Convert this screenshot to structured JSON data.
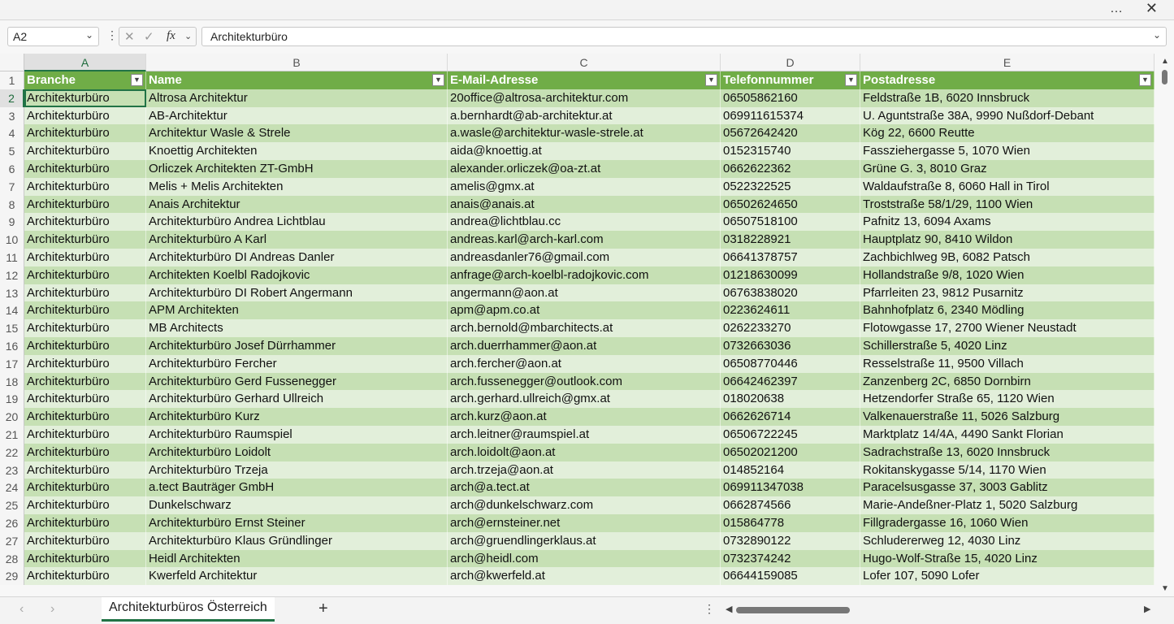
{
  "window": {
    "more_icon": "…",
    "close_icon": "✕"
  },
  "formula_bar": {
    "name_box": "A2",
    "formula": "Architekturbüro",
    "fx": "fx"
  },
  "columns": [
    "A",
    "B",
    "C",
    "D",
    "E"
  ],
  "headers": [
    "Branche",
    "Name",
    "E-Mail-Adresse",
    "Telefonnummer",
    "Postadresse"
  ],
  "rows": [
    [
      "2",
      "Architekturbüro",
      "Altrosa Architektur",
      "20office@altrosa-architektur.com",
      "06505862160",
      "Feldstraße 1B, 6020 Innsbruck"
    ],
    [
      "3",
      "Architekturbüro",
      "AB-Architektur",
      "a.bernhardt@ab-architektur.at",
      "069911615374",
      "U. Aguntstraße 38A, 9990 Nußdorf-Debant"
    ],
    [
      "4",
      "Architekturbüro",
      "Architektur Wasle & Strele",
      "a.wasle@architektur-wasle-strele.at",
      "05672642420",
      "Kög 22, 6600 Reutte"
    ],
    [
      "5",
      "Architekturbüro",
      "Knoettig Architekten",
      "aida@knoettig.at",
      "0152315740",
      "Fassziehergasse 5, 1070 Wien"
    ],
    [
      "6",
      "Architekturbüro",
      "Orliczek Architekten ZT-GmbH",
      "alexander.orliczek@oa-zt.at",
      "0662622362",
      "Grüne G. 3, 8010 Graz"
    ],
    [
      "7",
      "Architekturbüro",
      "Melis + Melis Architekten",
      "amelis@gmx.at",
      "0522322525",
      "Waldaufstraße 8, 6060 Hall in Tirol"
    ],
    [
      "8",
      "Architekturbüro",
      "Anais Architektur",
      "anais@anais.at",
      "06502624650",
      "Troststraße 58/1/29, 1100 Wien"
    ],
    [
      "9",
      "Architekturbüro",
      "Architekturbüro Andrea Lichtblau",
      "andrea@lichtblau.cc",
      "06507518100",
      "Pafnitz 13, 6094 Axams"
    ],
    [
      "10",
      "Architekturbüro",
      "Architekturbüro A Karl",
      "andreas.karl@arch-karl.com",
      "0318228921",
      "Hauptplatz 90, 8410 Wildon"
    ],
    [
      "11",
      "Architekturbüro",
      "Architekturbüro DI Andreas Danler",
      "andreasdanler76@gmail.com",
      "06641378757",
      "Zachbichlweg 9B, 6082 Patsch"
    ],
    [
      "12",
      "Architekturbüro",
      "Architekten Koelbl Radojkovic",
      "anfrage@arch-koelbl-radojkovic.com",
      "01218630099",
      "Hollandstraße 9/8, 1020 Wien"
    ],
    [
      "13",
      "Architekturbüro",
      "Architekturbüro DI Robert Angermann",
      "angermann@aon.at",
      "06763838020",
      "Pfarrleiten 23, 9812 Pusarnitz"
    ],
    [
      "14",
      "Architekturbüro",
      "APM Architekten",
      "apm@apm.co.at",
      "0223624611",
      "Bahnhofplatz 6, 2340 Mödling"
    ],
    [
      "15",
      "Architekturbüro",
      "MB Architects",
      "arch.bernold@mbarchitects.at",
      "0262233270",
      "Flotowgasse 17, 2700 Wiener Neustadt"
    ],
    [
      "16",
      "Architekturbüro",
      "Architekturbüro Josef Dürrhammer",
      "arch.duerrhammer@aon.at",
      "0732663036",
      "Schillerstraße 5, 4020 Linz"
    ],
    [
      "17",
      "Architekturbüro",
      "Architekturbüro Fercher",
      "arch.fercher@aon.at",
      "06508770446",
      "Resselstraße 11, 9500 Villach"
    ],
    [
      "18",
      "Architekturbüro",
      "Architekturbüro Gerd Fussenegger",
      "arch.fussenegger@outlook.com",
      "06642462397",
      "Zanzenberg 2C, 6850 Dornbirn"
    ],
    [
      "19",
      "Architekturbüro",
      "Architekturbüro Gerhard Ullreich",
      "arch.gerhard.ullreich@gmx.at",
      "018020638",
      "Hetzendorfer Straße 65, 1120 Wien"
    ],
    [
      "20",
      "Architekturbüro",
      "Architekturbüro Kurz",
      "arch.kurz@aon.at",
      "0662626714",
      "Valkenauerstraße 11, 5026 Salzburg"
    ],
    [
      "21",
      "Architekturbüro",
      "Architekturbüro Raumspiel",
      "arch.leitner@raumspiel.at",
      "06506722245",
      "Marktplatz 14/4A, 4490 Sankt Florian"
    ],
    [
      "22",
      "Architekturbüro",
      "Architekturbüro Loidolt",
      "arch.loidolt@aon.at",
      "06502021200",
      "Sadrachstraße 13, 6020 Innsbruck"
    ],
    [
      "23",
      "Architekturbüro",
      "Architekturbüro Trzeja",
      "arch.trzeja@aon.at",
      "014852164",
      "Rokitanskygasse 5/14, 1170 Wien"
    ],
    [
      "24",
      "Architekturbüro",
      "a.tect Bauträger GmbH",
      "arch@a.tect.at",
      "069911347038",
      "Paracelsusgasse 37, 3003 Gablitz"
    ],
    [
      "25",
      "Architekturbüro",
      "Dunkelschwarz",
      "arch@dunkelschwarz.com",
      "0662874566",
      "Marie-Andeßner-Platz 1, 5020 Salzburg"
    ],
    [
      "26",
      "Architekturbüro",
      "Architekturbüro Ernst Steiner",
      "arch@ernsteiner.net",
      "015864778",
      "Fillgradergasse 16, 1060 Wien"
    ],
    [
      "27",
      "Architekturbüro",
      "Architekturbüro Klaus Gründlinger",
      "arch@gruendlingerklaus.at",
      "0732890122",
      "Schludererweg 12, 4030 Linz"
    ],
    [
      "28",
      "Architekturbüro",
      "Heidl Architekten",
      "arch@heidl.com",
      "0732374242",
      "Hugo-Wolf-Straße 15, 4020 Linz"
    ],
    [
      "29",
      "Architekturbüro",
      "Kwerfeld Architektur",
      "arch@kwerfeld.at",
      "06644159085",
      "Lofer 107, 5090 Lofer"
    ]
  ],
  "sheet_tab": "Architekturbüros Österreich",
  "colors": {
    "header_green": "#70ad47",
    "band_dark": "#c6e0b4",
    "band_light": "#e2efda",
    "accent": "#217346"
  }
}
